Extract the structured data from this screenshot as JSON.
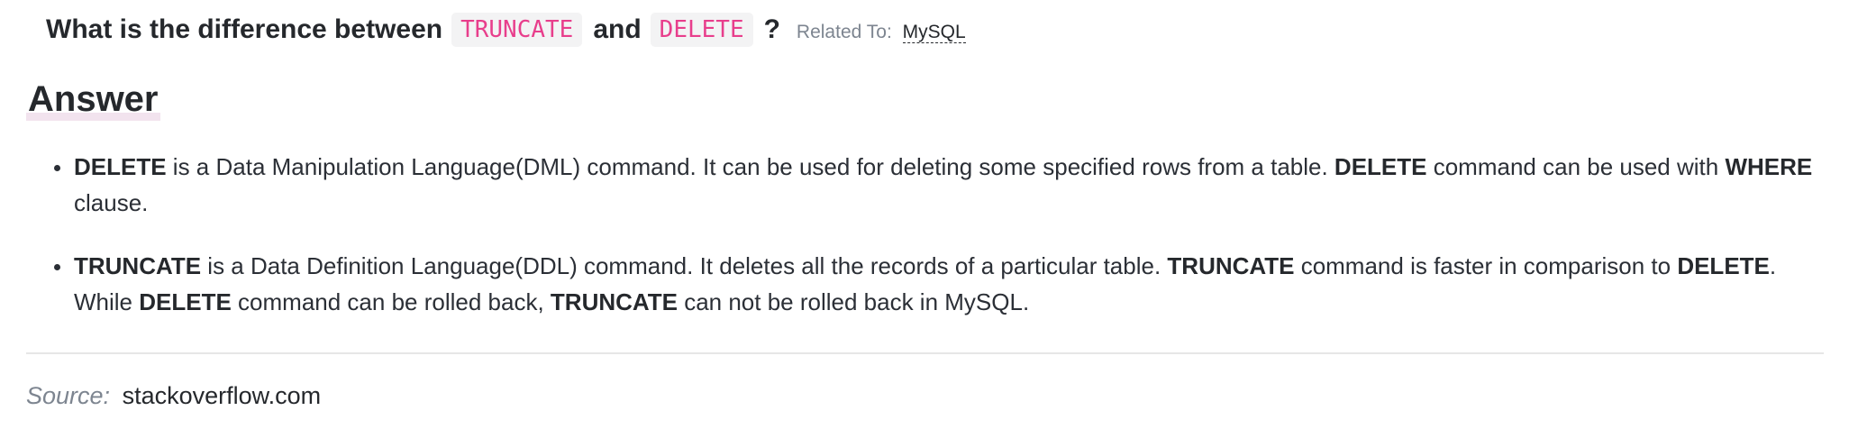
{
  "question": {
    "prefix": "What is the difference between",
    "code_1": "TRUNCATE",
    "middle": "and",
    "code_2": "DELETE",
    "suffix": "?",
    "related_label": "Related To:",
    "related_tag": "MySQL"
  },
  "answer": {
    "heading": "Answer",
    "item_1": {
      "b1": "DELETE",
      "t1": " is a Data Manipulation Language(DML) command. It can be used for deleting some specified rows from a table. ",
      "b2": "DELETE",
      "t2": " command can be used with ",
      "b3": "WHERE",
      "t3": " clause."
    },
    "item_2": {
      "b1": "TRUNCATE",
      "t1": " is a Data Definition Language(DDL) command. It deletes all the records of a particular table. ",
      "b2": "TRUNCATE",
      "t2": " command is faster in comparison to ",
      "b3": "DELETE",
      "t3": ". While ",
      "b4": "DELETE",
      "t4": " command can be rolled back, ",
      "b5": "TRUNCATE",
      "t5": " can not be rolled back in MySQL."
    }
  },
  "source": {
    "label": "Source:",
    "value": "stackoverflow.com"
  }
}
